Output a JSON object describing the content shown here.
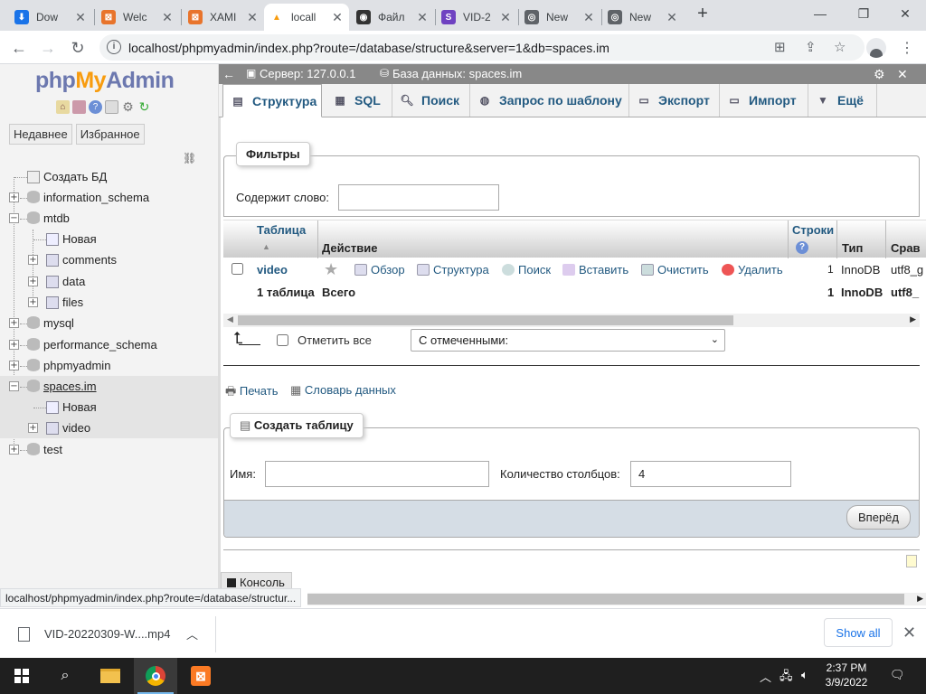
{
  "browser": {
    "tabs": [
      {
        "label": "Dow",
        "color": "#1a73e8",
        "glyph": "⬇"
      },
      {
        "label": "Welc",
        "color": "#e8742c",
        "glyph": "⊠"
      },
      {
        "label": "XAMI",
        "color": "#e8742c",
        "glyph": "⊠"
      },
      {
        "label": "locall",
        "color": "#f89c0e",
        "glyph": "▲"
      },
      {
        "label": "Файл",
        "color": "#333333",
        "glyph": "◉"
      },
      {
        "label": "VID-2",
        "color": "#6f42c1",
        "glyph": "S"
      },
      {
        "label": "New",
        "color": "#5f6368",
        "glyph": "◎"
      },
      {
        "label": "New",
        "color": "#5f6368",
        "glyph": "◎"
      }
    ],
    "new_tab": "+",
    "url": "localhost/phpmyadmin/index.php?route=/database/structure&server=1&db=spaces.im"
  },
  "sidebar": {
    "logo": {
      "php": "php",
      "my": "My",
      "admin": "Admin"
    },
    "tabs": [
      "Недавнее",
      "Избранное"
    ],
    "tree": [
      {
        "label": "Создать БД",
        "level": 0,
        "kind": "new"
      },
      {
        "label": "information_schema",
        "level": 0,
        "kind": "db"
      },
      {
        "label": "mtdb",
        "level": 0,
        "kind": "db-open"
      },
      {
        "label": "Новая",
        "level": 1,
        "kind": "new"
      },
      {
        "label": "comments",
        "level": 1,
        "kind": "table"
      },
      {
        "label": "data",
        "level": 1,
        "kind": "table"
      },
      {
        "label": "files",
        "level": 1,
        "kind": "table"
      },
      {
        "label": "mysql",
        "level": 0,
        "kind": "db"
      },
      {
        "label": "performance_schema",
        "level": 0,
        "kind": "db"
      },
      {
        "label": "phpmyadmin",
        "level": 0,
        "kind": "db"
      },
      {
        "label": "spaces.im",
        "level": 0,
        "kind": "db-open-selected"
      },
      {
        "label": "Новая",
        "level": 1,
        "kind": "new"
      },
      {
        "label": "video",
        "level": 1,
        "kind": "table"
      },
      {
        "label": "test",
        "level": 0,
        "kind": "db"
      }
    ]
  },
  "breadcrumb": {
    "server": "Сервер: 127.0.0.1",
    "database": "База данных: spaces.im"
  },
  "main_tabs": [
    "Структура",
    "SQL",
    "Поиск",
    "Запрос по шаблону",
    "Экспорт",
    "Импорт",
    "Ещё"
  ],
  "filters": {
    "legend": "Фильтры",
    "label": "Содержит слово:",
    "value": ""
  },
  "table": {
    "headers": {
      "table": "Таблица",
      "action": "Действие",
      "rows": "Строки",
      "type": "Тип",
      "collation": "Срав"
    },
    "rows": [
      {
        "name": "video",
        "actions": [
          "Обзор",
          "Структура",
          "Поиск",
          "Вставить",
          "Очистить",
          "Удалить"
        ],
        "rows": "1",
        "type": "InnoDB",
        "collation": "utf8_g"
      }
    ],
    "footer": {
      "count": "1 таблица",
      "label": "Всего",
      "rows": "1",
      "type": "InnoDB",
      "collation": "utf8_"
    }
  },
  "bulk": {
    "check_all": "Отметить все",
    "with_selected": "С отмеченными:"
  },
  "links": {
    "print": "Печать",
    "dictionary": "Словарь данных"
  },
  "create": {
    "legend": "Создать таблицу",
    "name_label": "Имя:",
    "name_value": "",
    "cols_label": "Количество столбцов:",
    "cols_value": "4",
    "go_button": "Вперёд"
  },
  "console_label": "Консоль",
  "status_url": "localhost/phpmyadmin/index.php?route=/database/structur...",
  "download": {
    "file": "VID-20220309-W....mp4",
    "show_all": "Show all"
  },
  "taskbar": {
    "time": "2:37 PM",
    "date": "3/9/2022"
  }
}
